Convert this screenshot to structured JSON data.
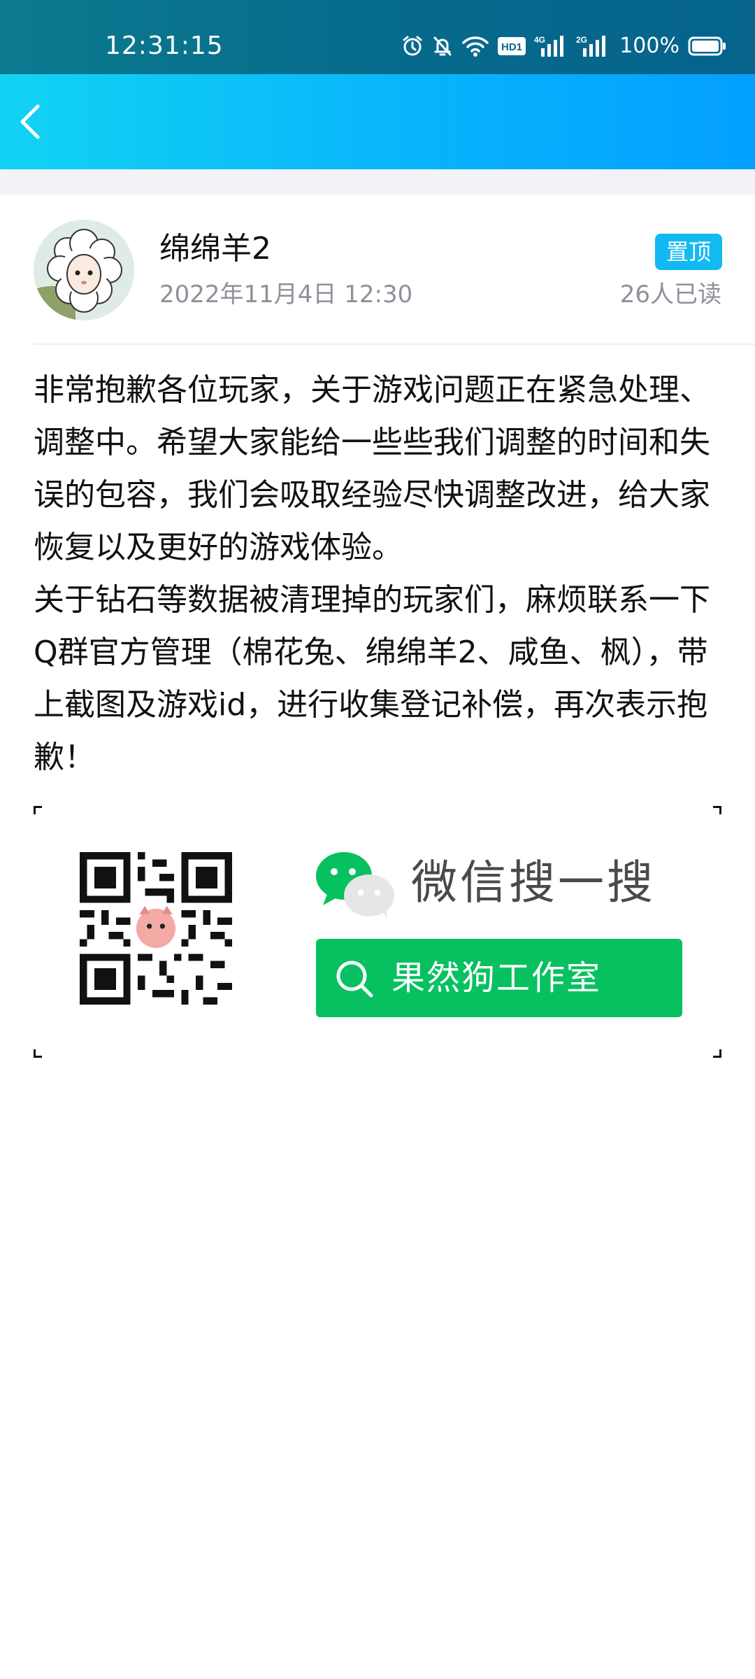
{
  "status_bar": {
    "time": "12:31:15",
    "icons": [
      "alarm-icon",
      "mute-bell-icon",
      "wifi-icon",
      "hd-icon",
      "4g-signal-icon",
      "2g-signal-icon",
      "battery-icon"
    ],
    "hd_label": "HD1",
    "net_4g": "4G",
    "net_2g": "2G",
    "battery_percent": "100%"
  },
  "app_bar": {
    "back_icon": "chevron-left-icon"
  },
  "post": {
    "author": "绵绵羊2",
    "time": "2022年11月4日 12:30",
    "pin_badge": "置顶",
    "read_count": "26人已读",
    "body": "非常抱歉各位玩家，关于游戏问题正在紧急处理、调整中。希望大家能给一些些我们调整的时间和失误的包容，我们会吸取经验尽快调整改进，给大家恢复以及更好的游戏体验。\n关于钻石等数据被清理掉的玩家们，麻烦联系一下Q群官方管理（棉花兔、绵绵羊2、咸鱼、枫），带上截图及游戏id，进行收集登记补偿，再次表示抱歉！"
  },
  "wechat_card": {
    "title": "微信搜一搜",
    "search_label": "果然狗工作室"
  },
  "colors": {
    "status_bar": "#076a8c",
    "app_bar_start": "#12d3f3",
    "app_bar_end": "#03a0ff",
    "badge": "#12b9f3",
    "wechat_green": "#07c160"
  }
}
